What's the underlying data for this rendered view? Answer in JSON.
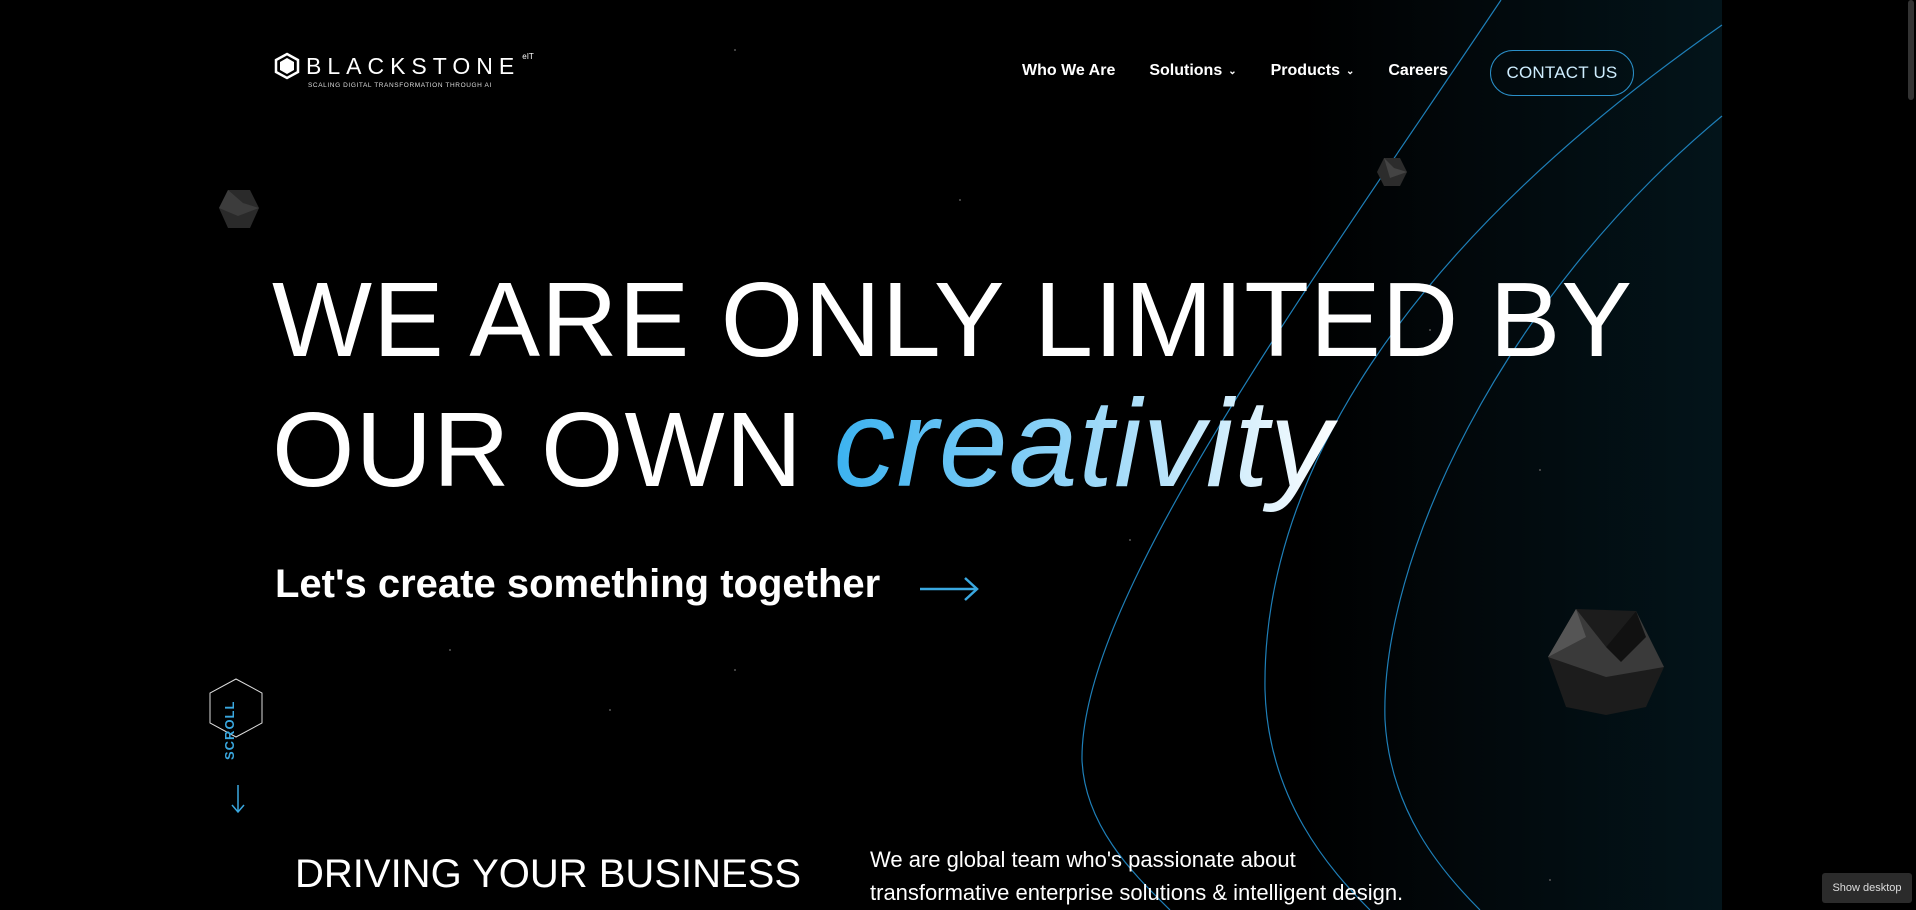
{
  "brand": {
    "name": "BLACKSTONE",
    "superscript": "eIT",
    "tagline": "SCALING DIGITAL TRANSFORMATION THROUGH AI"
  },
  "nav": {
    "items": [
      {
        "label": "Who We Are"
      },
      {
        "label": "Solutions"
      },
      {
        "label": "Products"
      },
      {
        "label": "Careers"
      }
    ],
    "chevron": "⌄",
    "contact_label": "CONTACT US"
  },
  "hero": {
    "line1": "WE ARE ONLY LIMITED BY",
    "line2_prefix": "OUR OWN ",
    "line2_highlight": "creativity",
    "cta": "Let's create something together"
  },
  "scroll": {
    "label": "SCROLL"
  },
  "section": {
    "heading": "DRIVING YOUR BUSINESS",
    "paragraph": "We are global team who's passionate about transformative enterprise solutions & intelligent design. Our team creates an"
  },
  "system": {
    "tooltip": "Show desktop"
  },
  "colors": {
    "accent": "#3bb2f0",
    "line": "#1e7fb8"
  }
}
